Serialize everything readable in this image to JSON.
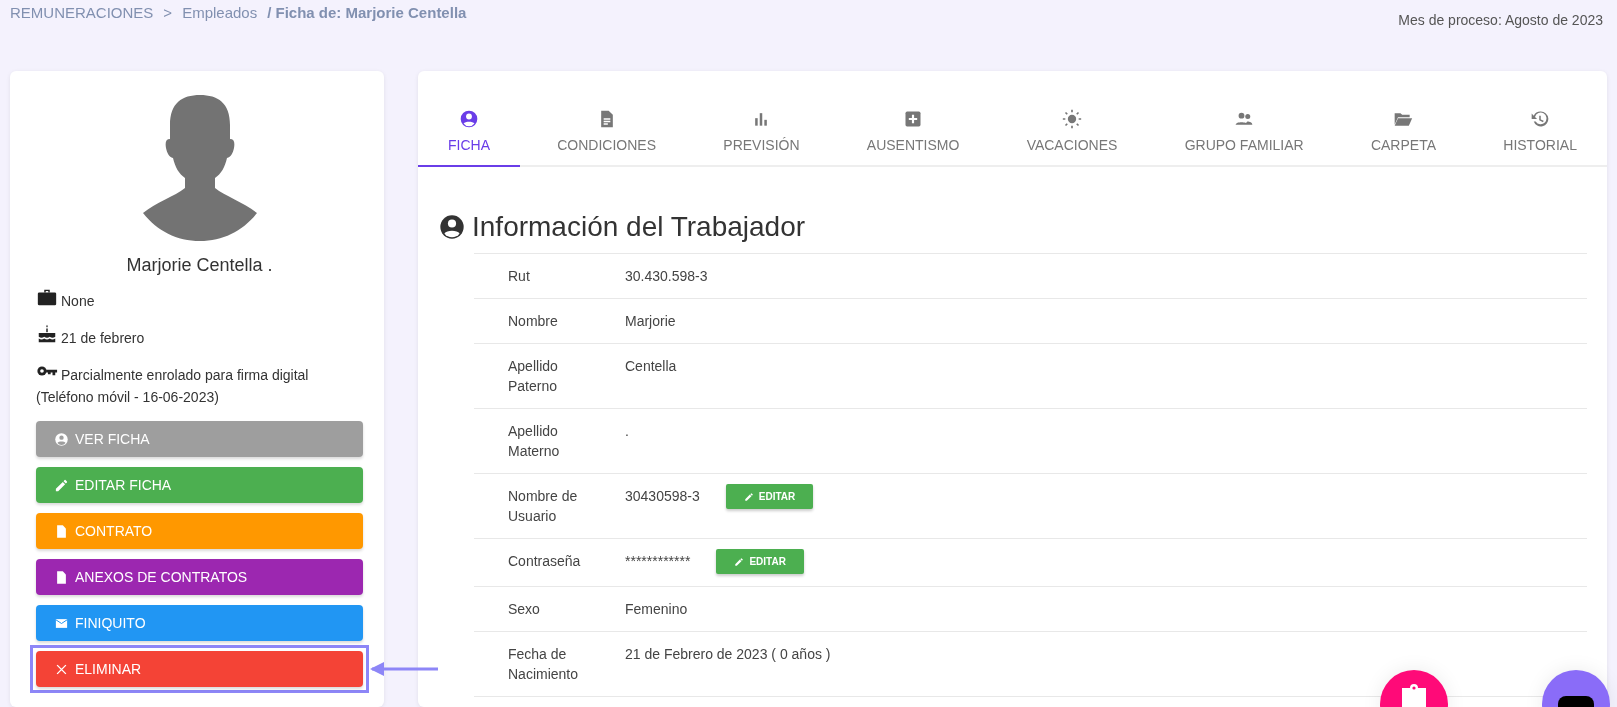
{
  "breadcrumb": {
    "root": "REMUNERACIONES",
    "separator": ">",
    "section": "Empleados",
    "current": "/ Ficha de: Marjorie Centella"
  },
  "process_month": "Mes de proceso: Agosto de 2023",
  "profile": {
    "name": "Marjorie Centella .",
    "details": [
      {
        "kind": "briefcase",
        "text": "None"
      },
      {
        "kind": "cake",
        "text": "21 de febrero"
      },
      {
        "kind": "key",
        "text": "Parcialmente enrolado para firma digital (Teléfono móvil - 16-06-2023)"
      }
    ],
    "buttons": [
      {
        "kind": "user",
        "label": "VER FICHA",
        "color": "#9e9e9e",
        "highlighted": false
      },
      {
        "kind": "pencil",
        "label": "EDITAR FICHA",
        "color": "#4caf50",
        "highlighted": false
      },
      {
        "kind": "doc",
        "label": "CONTRATO",
        "color": "#ff9800",
        "highlighted": false
      },
      {
        "kind": "doc",
        "label": "ANEXOS DE CONTRATOS",
        "color": "#9c27b0",
        "highlighted": false
      },
      {
        "kind": "mail",
        "label": "FINIQUITO",
        "color": "#2196f3",
        "highlighted": false
      },
      {
        "kind": "close",
        "label": "ELIMINAR",
        "color": "#f44336",
        "highlighted": true
      }
    ]
  },
  "tabs": [
    {
      "kind": "user",
      "label": "FICHA",
      "selected": true
    },
    {
      "kind": "doc",
      "label": "CONDICIONES",
      "selected": false
    },
    {
      "kind": "chart",
      "label": "PREVISIÓN",
      "selected": false
    },
    {
      "kind": "plus",
      "label": "AUSENTISMO",
      "selected": false
    },
    {
      "kind": "sun",
      "label": "VACACIONES",
      "selected": false
    },
    {
      "kind": "people",
      "label": "GRUPO FAMILIAR",
      "selected": false
    },
    {
      "kind": "folder",
      "label": "CARPETA",
      "selected": false
    },
    {
      "kind": "history",
      "label": "HISTORIAL",
      "selected": false
    }
  ],
  "section_title": "Información del Trabajador",
  "fields": [
    {
      "label": "Rut",
      "value": "30.430.598-3"
    },
    {
      "label": "Nombre",
      "value": "Marjorie"
    },
    {
      "label": "Apellido Paterno",
      "value": "Centella"
    },
    {
      "label": "Apellido Materno",
      "value": "."
    },
    {
      "label": "Nombre de Usuario",
      "value": "30430598-3",
      "button": "EDITAR"
    },
    {
      "label": "Contraseña",
      "value": "************",
      "button": "EDITAR"
    },
    {
      "label": "Sexo",
      "value": "Femenino"
    },
    {
      "label": "Fecha de Nacimiento",
      "value": "21 de Febrero de 2023 ( 0 años )"
    }
  ]
}
